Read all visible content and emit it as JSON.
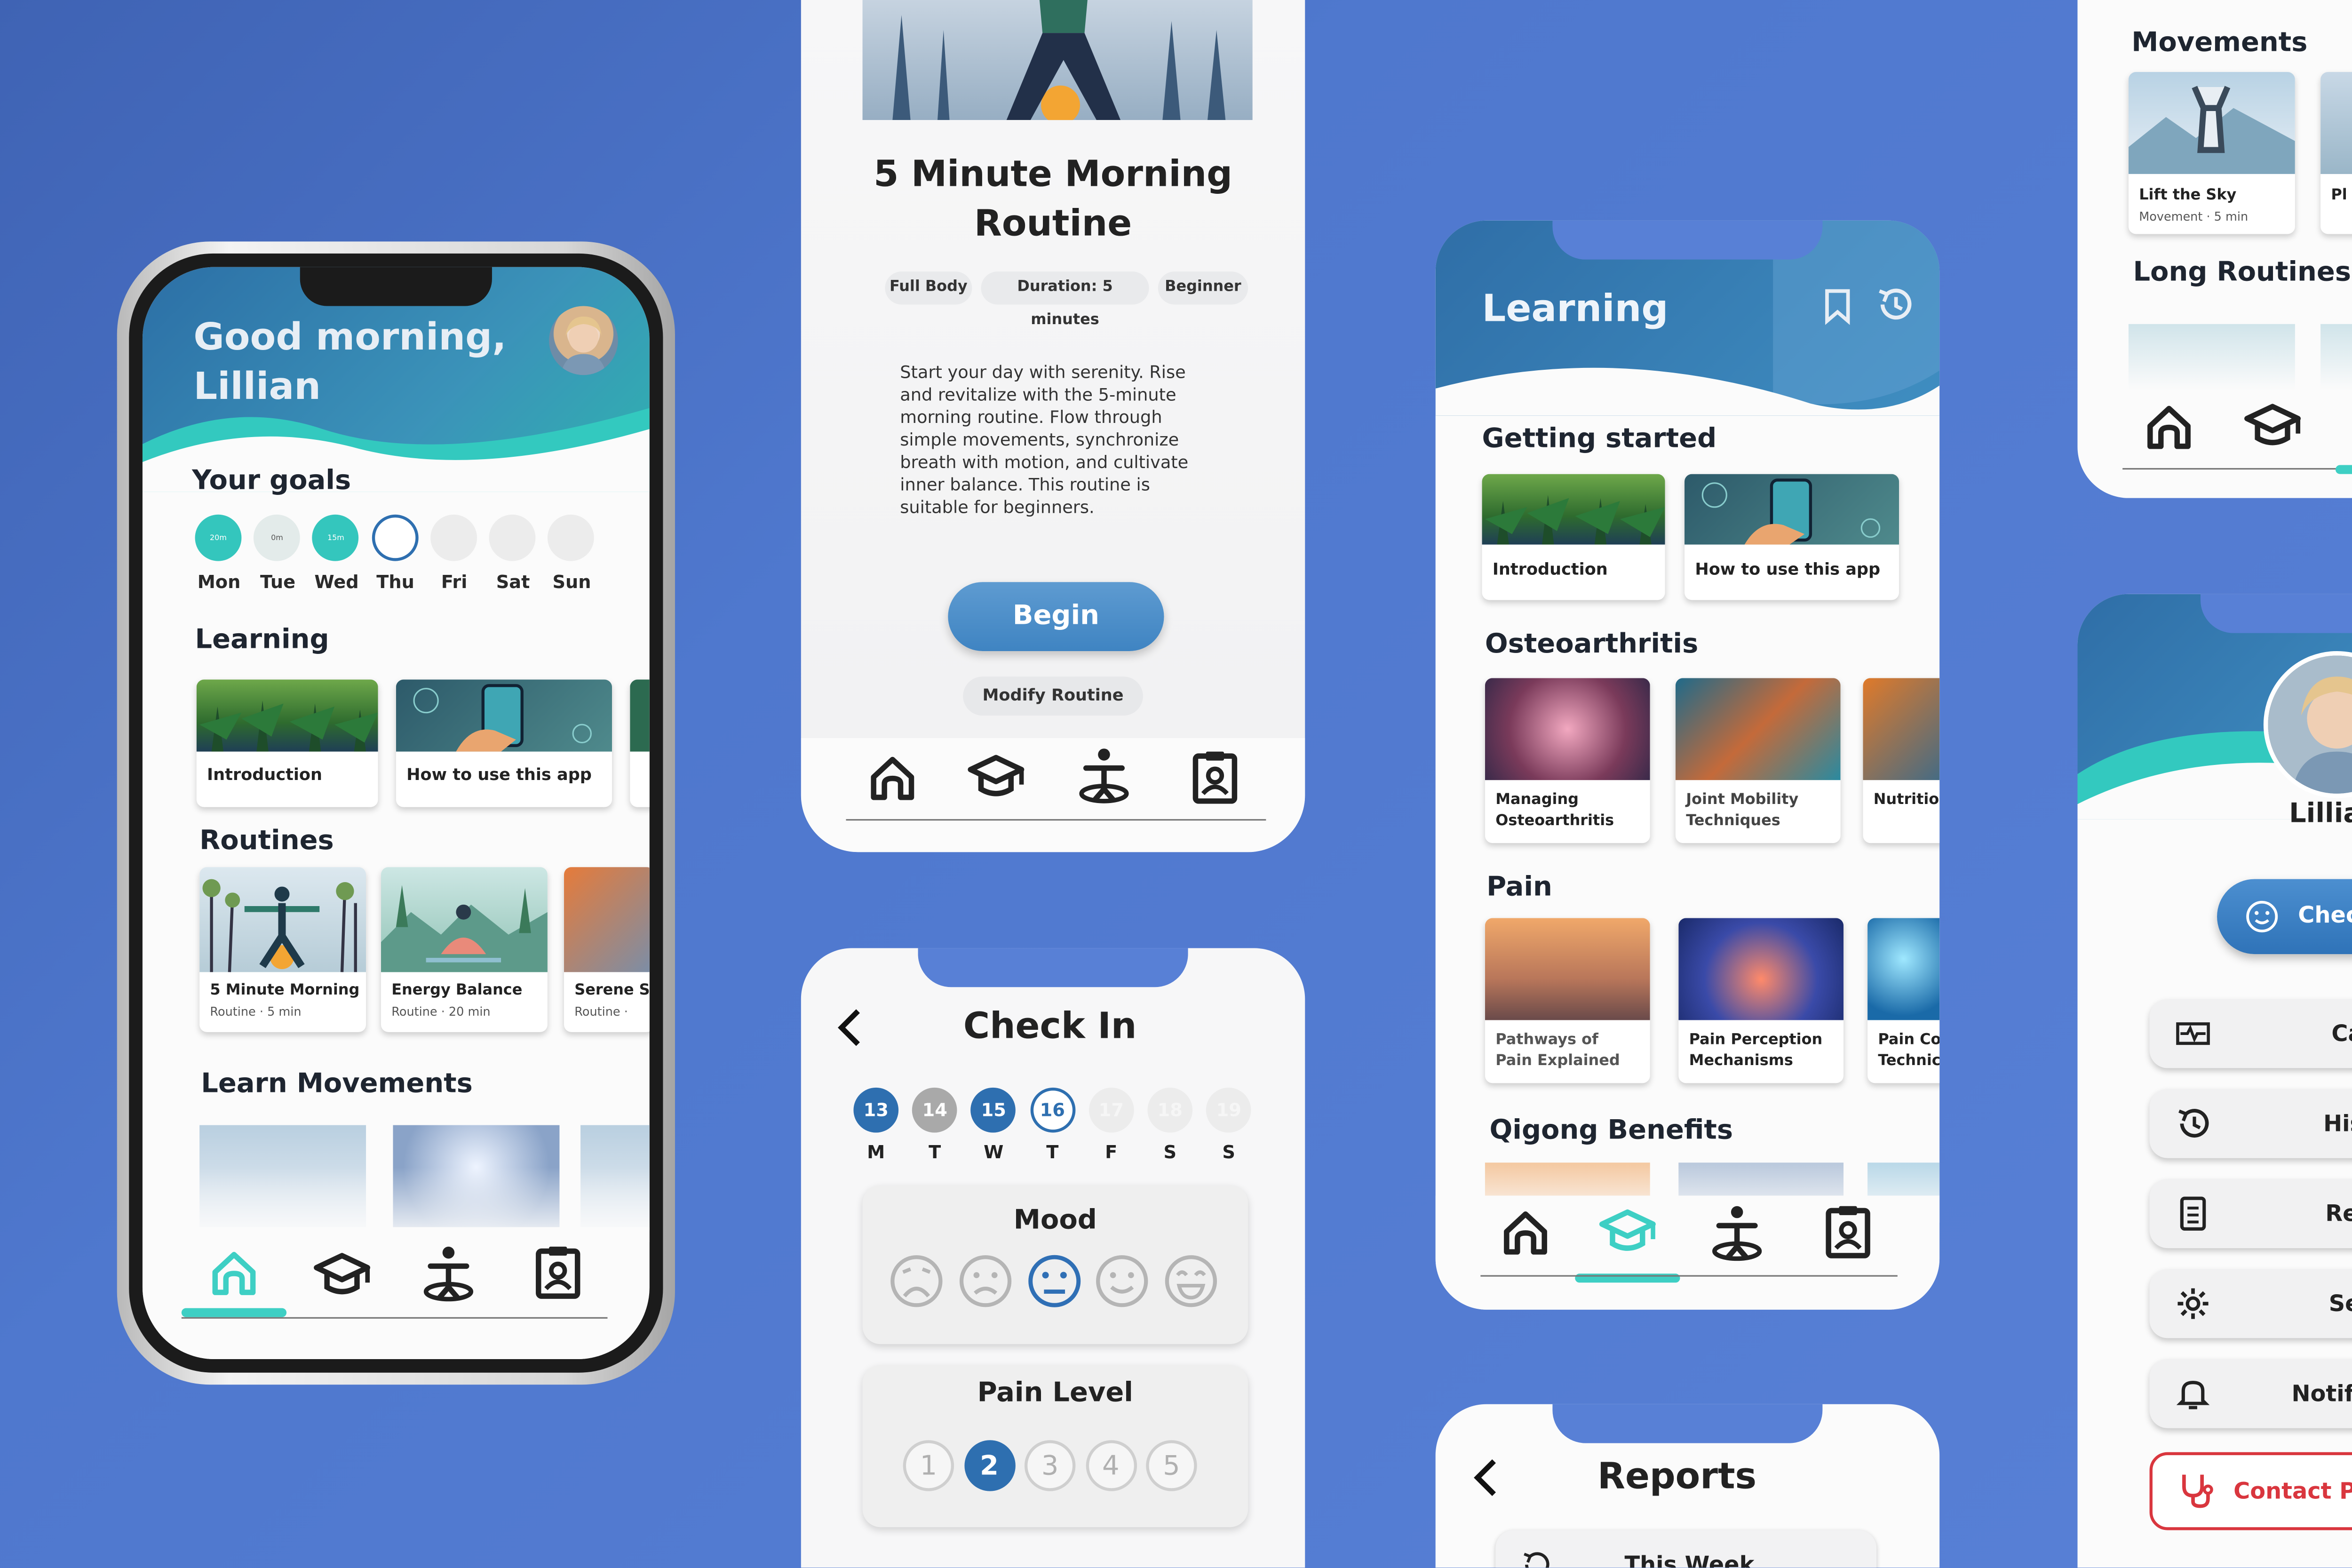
{
  "home": {
    "greeting": "Good morning, Lillian",
    "goals_title": "Your goals",
    "goals": [
      {
        "day": "Mon",
        "value": "20m"
      },
      {
        "day": "Tue",
        "value": "0m"
      },
      {
        "day": "Wed",
        "value": "15m"
      },
      {
        "day": "Thu",
        "value": ""
      },
      {
        "day": "Fri",
        "value": ""
      },
      {
        "day": "Sat",
        "value": ""
      },
      {
        "day": "Sun",
        "value": ""
      }
    ],
    "learning_title": "Learning",
    "learning_cards": [
      "Introduction",
      "How to use this app"
    ],
    "routines_title": "Routines",
    "routines": [
      {
        "title": "5 Minute Morning",
        "meta": "Routine · 5 min"
      },
      {
        "title": "Energy Balance",
        "meta": "Routine · 20 min"
      },
      {
        "title": "Serene S",
        "meta": "Routine ·"
      }
    ],
    "movements_title": "Learn Movements"
  },
  "routine_detail": {
    "title": "5 Minute Morning Routine",
    "tags": [
      "Full Body",
      "Duration: 5 minutes",
      "Beginner"
    ],
    "description": "Start your day with serenity. Rise and revitalize with the 5-minute morning routine. Flow through simple movements, synchronize breath with motion, and cultivate inner balance. This routine is suitable for beginners.",
    "begin_label": "Begin",
    "modify_label": "Modify Routine"
  },
  "checkin": {
    "title": "Check In",
    "dates": [
      {
        "num": "13",
        "day": "M",
        "state": "done"
      },
      {
        "num": "14",
        "day": "T",
        "state": "missed"
      },
      {
        "num": "15",
        "day": "W",
        "state": "done"
      },
      {
        "num": "16",
        "day": "T",
        "state": "today"
      },
      {
        "num": "17",
        "day": "F",
        "state": "future"
      },
      {
        "num": "18",
        "day": "S",
        "state": "future"
      },
      {
        "num": "19",
        "day": "S",
        "state": "future"
      }
    ],
    "mood_title": "Mood",
    "pain_title": "Pain Level",
    "pain_levels": [
      "1",
      "2",
      "3",
      "4",
      "5"
    ],
    "pain_selected": 2,
    "mood_selected": 2
  },
  "learning": {
    "title": "Learning",
    "getting_started_title": "Getting started",
    "getting_started": [
      "Introduction",
      "How to use this app"
    ],
    "osteo_title": "Osteoarthritis",
    "osteo": [
      "Managing Osteoarthritis",
      "Joint Mobility Techniques",
      "Nutritio"
    ],
    "pain_title": "Pain",
    "pain": [
      "Pathways of Pain Explained",
      "Pain Perception Mechanisms",
      "Pain Co Technic"
    ],
    "qigong_title": "Qigong Benefits"
  },
  "reports": {
    "title": "Reports",
    "row_label": "This Week"
  },
  "library": {
    "movements_title": "Movements",
    "movement_card": {
      "title": "Lift the Sky",
      "meta": "Movement · 5 min"
    },
    "movement_card_2": "Pl",
    "long_title": "Long Routines"
  },
  "profile": {
    "name": "Lillia",
    "checkin_label": "Chec",
    "menu": [
      "Care",
      "Histo",
      "Repo",
      "Setti",
      "Notifica"
    ],
    "contact_label": "Contact Pr"
  },
  "colors": {
    "background": "#4f78ce",
    "teal": "#34c6bd",
    "blue": "#2e6fb0",
    "dark": "#1e2530",
    "danger": "#d9363e"
  },
  "icons": [
    "home-icon",
    "graduation-cap-icon",
    "figure-icon",
    "clipboard-user-icon",
    "bookmark-icon",
    "history-icon",
    "back-chevron-icon",
    "smiley-icon",
    "activity-icon",
    "report-icon",
    "gear-icon",
    "bell-icon",
    "stethoscope-icon"
  ]
}
